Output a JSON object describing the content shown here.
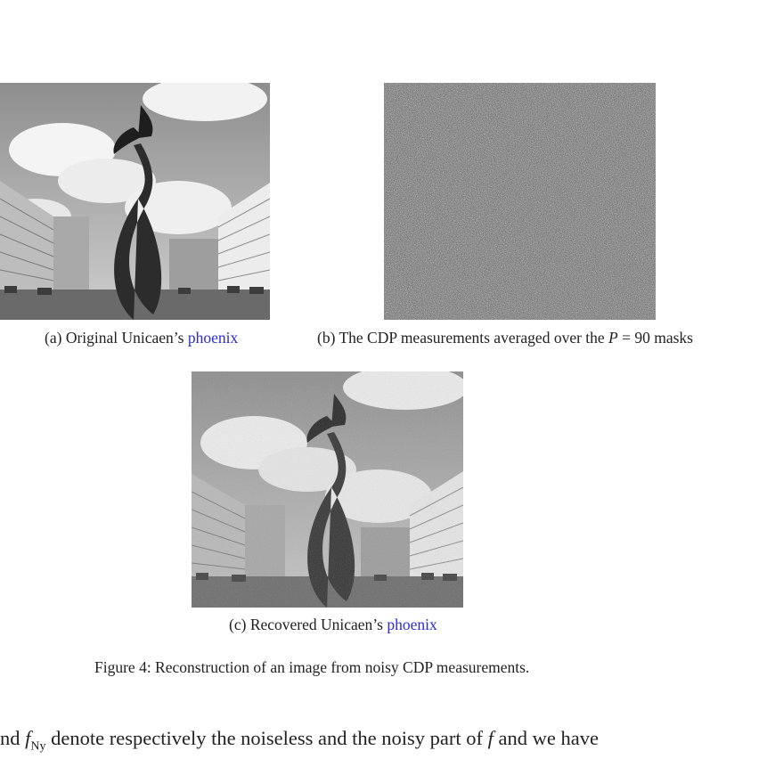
{
  "subfigures": [
    {
      "label": "(a)",
      "text": "Original Unicaen’s ",
      "link": "phoenix",
      "image": "original-phoenix-photo"
    },
    {
      "label": "(b)",
      "text_before": "The CDP measurements averaged over the ",
      "var": "P",
      "text_after": " = 90 masks",
      "image": "cdp-noise-measurements"
    },
    {
      "label": "(c)",
      "text": "Recovered Unicaen’s ",
      "link": "phoenix",
      "image": "recovered-phoenix-photo"
    }
  ],
  "figure_caption": "Figure 4: Reconstruction of an image from noisy CDP measurements.",
  "body_line": {
    "prefix": "nd ",
    "f": "f",
    "sub": "Ny",
    "middle": " denote respectively the noiseless and the noisy part of ",
    "f2": "f",
    "suffix": " and we have"
  }
}
